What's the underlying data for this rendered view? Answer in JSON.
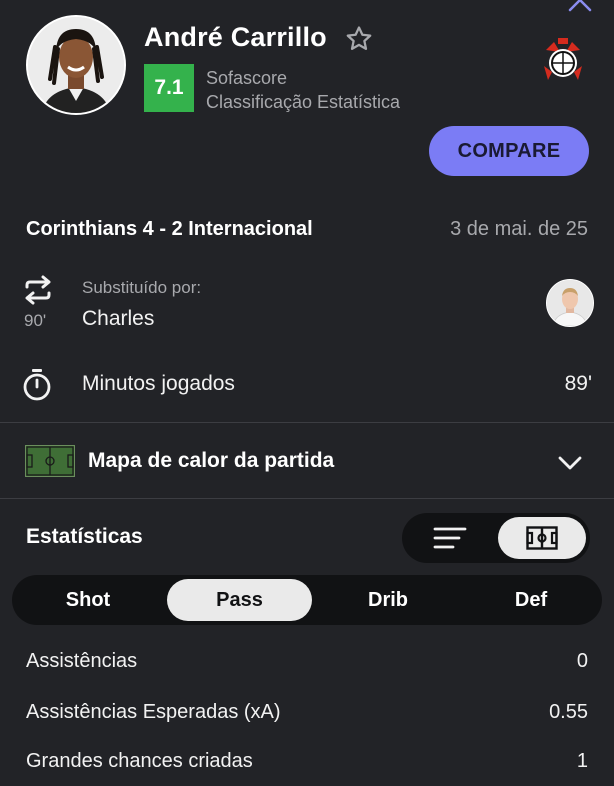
{
  "player": {
    "name": "André Carrillo",
    "rating": "7.1",
    "rating_source": "Sofascore",
    "rating_caption": "Classificação Estatística"
  },
  "actions": {
    "compare_label": "COMPARE"
  },
  "match": {
    "title": "Corinthians 4 - 2 Internacional",
    "date": "3 de mai. de 25"
  },
  "substitution": {
    "minute": "90'",
    "label": "Substituído por:",
    "player": "Charles"
  },
  "minutes_played": {
    "label": "Minutos jogados",
    "value": "89'"
  },
  "heatmap": {
    "label": "Mapa de calor da partida"
  },
  "statistics": {
    "title": "Estatísticas",
    "tabs": [
      {
        "label": "Shot",
        "active": false
      },
      {
        "label": "Pass",
        "active": true
      },
      {
        "label": "Drib",
        "active": false
      },
      {
        "label": "Def",
        "active": false
      }
    ],
    "rows": [
      {
        "label": "Assistências",
        "value": "0"
      },
      {
        "label": "Assistências Esperadas (xA)",
        "value": "0.55"
      },
      {
        "label": "Grandes chances criadas",
        "value": "1"
      }
    ]
  },
  "icons": {
    "close": "close-icon",
    "favorite": "star-icon",
    "club": "corinthians-crest-icon",
    "substitution": "swap-arrows-icon",
    "minutes": "stopwatch-icon",
    "heatmap": "pitch-icon",
    "expand": "chevron-down-icon",
    "list_view": "list-icon",
    "pitch_view": "pitch-icon"
  },
  "colors": {
    "background": "#222327",
    "rating": "#34b24c",
    "accent": "#7b7cf5",
    "muted_text": "#a8a9ad"
  }
}
